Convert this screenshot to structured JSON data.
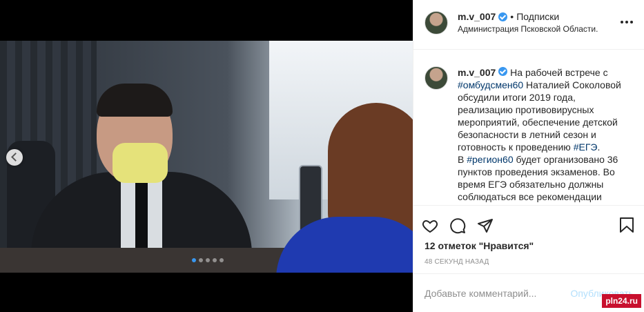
{
  "header": {
    "username": "m.v_007",
    "separator": "•",
    "follow_label": "Подписки",
    "location": "Администрация Псковской Области."
  },
  "caption": {
    "username": "m.v_007",
    "part1": "На рабочей встрече с ",
    "tag1": "#омбудсмен60",
    "part2": " Наталией Соколовой обсудили итоги 2019 года, реализацию противовирусных мероприятий, обеспечение детской безопасности в летний сезон и готовность к проведению ",
    "tag2": "#ЕГЭ",
    "part3": ".",
    "part4": "В ",
    "tag3": "#регион60",
    "part5": " будет организовано 36 пунктов проведения экзаменов. Во время ЕГЭ обязательно должны соблюдаться все рекомендации"
  },
  "likes": "12 отметок \"Нравится\"",
  "time": "48 СЕКУНД НАЗАД",
  "comment": {
    "placeholder": "Добавьте комментарий...",
    "post_label": "Опубликовать"
  },
  "watermark": "pln24.ru",
  "icons": [
    "heart-icon",
    "comment-icon",
    "share-icon",
    "bookmark-icon",
    "verified-badge-icon",
    "more-options-icon",
    "chevron-left-icon"
  ],
  "colors": {
    "accent": "#3897f0",
    "hashtag": "#00376b",
    "watermark_bg": "#c8102e"
  }
}
